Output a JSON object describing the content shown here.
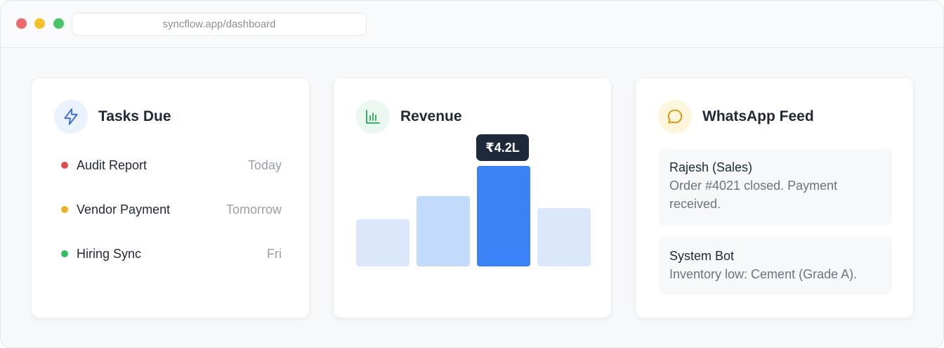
{
  "browser": {
    "url": "syncflow.app/dashboard"
  },
  "tasks_card": {
    "title": "Tasks Due",
    "icon": "lightning-icon",
    "items": [
      {
        "name": "Audit Report",
        "due": "Today",
        "color": "#e24c4c"
      },
      {
        "name": "Vendor Payment",
        "due": "Tomorrow",
        "color": "#e9b21e"
      },
      {
        "name": "Hiring Sync",
        "due": "Fri",
        "color": "#2fbf5f"
      }
    ]
  },
  "revenue_card": {
    "title": "Revenue",
    "icon": "bar-chart-icon",
    "tooltip": "₹4.2L"
  },
  "chart_data": {
    "type": "bar",
    "categories": [
      "",
      "",
      "",
      ""
    ],
    "values": [
      0.47,
      0.7,
      1.0,
      0.58
    ],
    "highlight_index": 2,
    "highlight_label": "₹4.2L",
    "bar_colors": [
      "#dbe8fc",
      "#c3dbfb",
      "#3b82f6",
      "#dbe8fc"
    ],
    "title": "Revenue",
    "xlabel": "",
    "ylabel": "",
    "grid": false
  },
  "feed_card": {
    "title": "WhatsApp Feed",
    "icon": "chat-bubble-icon",
    "messages": [
      {
        "from": "Rajesh (Sales)",
        "body": "Order #4021 closed. Payment received."
      },
      {
        "from": "System Bot",
        "body": "Inventory low: Cement (Grade A)."
      }
    ]
  },
  "colors": {
    "accent_blue": "#3b82f6",
    "tooltip_bg": "#1e293b"
  }
}
